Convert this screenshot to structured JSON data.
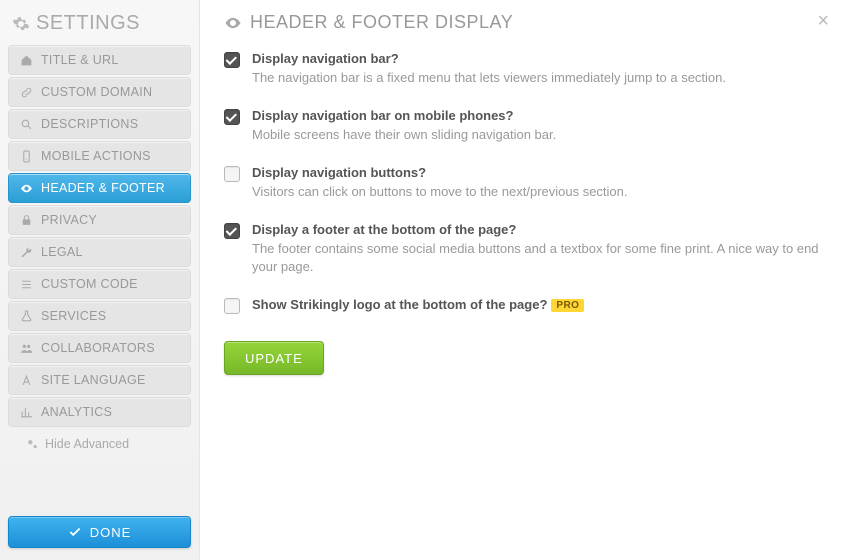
{
  "sidebar": {
    "title": "SETTINGS",
    "items": [
      {
        "label": "TITLE & URL",
        "icon": "home"
      },
      {
        "label": "CUSTOM DOMAIN",
        "icon": "link"
      },
      {
        "label": "DESCRIPTIONS",
        "icon": "search"
      },
      {
        "label": "MOBILE ACTIONS",
        "icon": "phone"
      },
      {
        "label": "HEADER & FOOTER",
        "icon": "eye",
        "active": true
      },
      {
        "label": "PRIVACY",
        "icon": "lock"
      },
      {
        "label": "LEGAL",
        "icon": "wrench"
      },
      {
        "label": "CUSTOM CODE",
        "icon": "list"
      },
      {
        "label": "SERVICES",
        "icon": "flask"
      },
      {
        "label": "COLLABORATORS",
        "icon": "users"
      },
      {
        "label": "SITE LANGUAGE",
        "icon": "font"
      },
      {
        "label": "ANALYTICS",
        "icon": "bar-chart"
      }
    ],
    "hide_advanced": "Hide Advanced",
    "done": "DONE"
  },
  "main": {
    "title": "HEADER & FOOTER DISPLAY",
    "options": [
      {
        "checked": true,
        "title": "Display navigation bar?",
        "desc": "The navigation bar is a fixed menu that lets viewers immediately jump to a section."
      },
      {
        "checked": true,
        "title": "Display navigation bar on mobile phones?",
        "desc": "Mobile screens have their own sliding navigation bar."
      },
      {
        "checked": false,
        "title": "Display navigation buttons?",
        "desc": "Visitors can click on buttons to move to the next/previous section."
      },
      {
        "checked": true,
        "title": "Display a footer at the bottom of the page?",
        "desc": "The footer contains some social media buttons and a textbox for some fine print. A nice way to end your page."
      },
      {
        "checked": false,
        "title": "Show Strikingly logo at the bottom of the page?",
        "desc": "",
        "badge": "PRO"
      }
    ],
    "update": "UPDATE"
  }
}
